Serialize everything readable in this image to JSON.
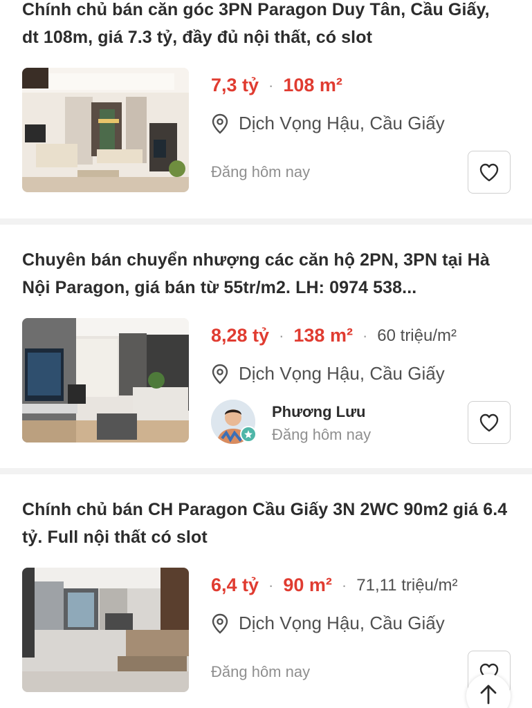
{
  "listings": [
    {
      "title": "Chính chủ bán căn góc 3PN Paragon Duy Tân, Cầu Giấy, dt 108m, giá 7.3 tỷ, đầy đủ nội thất, có slot",
      "price": "7,3 tỷ",
      "area": "108 m²",
      "price_per_m2": "",
      "location": "Dịch Vọng Hậu, Cầu Giấy",
      "posted": "Đăng hôm nay",
      "agent_name": ""
    },
    {
      "title": "Chuyên bán chuyển nhượng các căn hộ 2PN, 3PN tại Hà Nội Paragon, giá bán từ 55tr/m2. LH: 0974 538...",
      "price": "8,28 tỷ",
      "area": "138 m²",
      "price_per_m2": "60 triệu/m²",
      "location": "Dịch Vọng Hậu, Cầu Giấy",
      "posted": "Đăng hôm nay",
      "agent_name": "Phương Lưu"
    },
    {
      "title": "Chính chủ bán CH Paragon Cầu Giấy 3N 2WC 90m2 giá 6.4 tỷ. Full nội thất có slot",
      "price": "6,4 tỷ",
      "area": "90 m²",
      "price_per_m2": "71,11 triệu/m²",
      "location": "Dịch Vọng Hậu, Cầu Giấy",
      "posted": "Đăng hôm nay",
      "agent_name": ""
    }
  ],
  "separator": "·",
  "icons": {
    "location": "location-pin-icon",
    "favorite": "heart-outline-icon",
    "scroll_top": "arrow-up-icon",
    "verified": "verified-badge-icon"
  },
  "colors": {
    "price": "#e03c31",
    "text": "#2c2c2c",
    "muted": "#8f8f8f",
    "divider": "#f2f2f2"
  }
}
